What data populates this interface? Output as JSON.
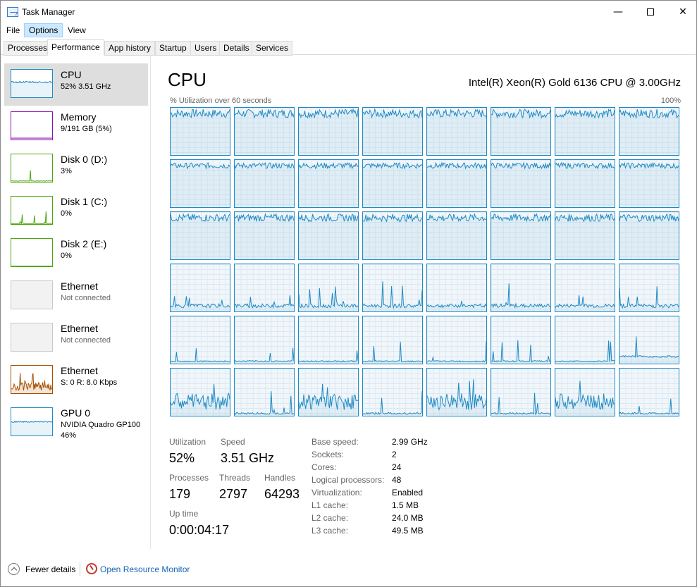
{
  "window": {
    "title": "Task Manager",
    "minimize_glyph": "—",
    "close_glyph": "✕"
  },
  "menu": [
    "File",
    "Options",
    "View"
  ],
  "tabs": [
    "Processes",
    "Performance",
    "App history",
    "Startup",
    "Users",
    "Details",
    "Services"
  ],
  "active_tab": "Performance",
  "sidebar": {
    "items": [
      {
        "name": "CPU",
        "sub": "52%  3.51 GHz",
        "color": "#1f8ac4",
        "selected": true
      },
      {
        "name": "Memory",
        "sub": "9/191 GB (5%)",
        "color": "#8b12ae"
      },
      {
        "name": "Disk 0 (D:)",
        "sub": "3%",
        "color": "#4da60c"
      },
      {
        "name": "Disk 1 (C:)",
        "sub": "0%",
        "color": "#4da60c"
      },
      {
        "name": "Disk 2 (E:)",
        "sub": "0%",
        "color": "#4da60c"
      },
      {
        "name": "Ethernet",
        "sub": "Not connected",
        "color": "#c0c0c0"
      },
      {
        "name": "Ethernet",
        "sub": "Not connected",
        "color": "#c0c0c0"
      },
      {
        "name": "Ethernet",
        "sub": "S: 0  R: 8.0 Kbps",
        "color": "#a74f01"
      },
      {
        "name": "GPU 0",
        "sub": "NVIDIA Quadro GP100",
        "sub2": "46%",
        "color": "#1f8ac4"
      }
    ]
  },
  "main": {
    "title": "CPU",
    "model": "Intel(R) Xeon(R) Gold 6136 CPU @ 3.00GHz",
    "graph_label": "% Utilization over 60 seconds",
    "graph_max": "100%",
    "line_color": "#1f8ac4"
  },
  "stats": {
    "utilization_label": "Utilization",
    "utilization": "52%",
    "speed_label": "Speed",
    "speed": "3.51 GHz",
    "processes_label": "Processes",
    "processes": "179",
    "threads_label": "Threads",
    "threads": "2797",
    "handles_label": "Handles",
    "handles": "64293",
    "uptime_label": "Up time",
    "uptime": "0:00:04:17"
  },
  "specs": [
    {
      "label": "Base speed:",
      "value": "2.99 GHz"
    },
    {
      "label": "Sockets:",
      "value": "2"
    },
    {
      "label": "Cores:",
      "value": "24"
    },
    {
      "label": "Logical processors:",
      "value": "48"
    },
    {
      "label": "Virtualization:",
      "value": "Enabled"
    },
    {
      "label": "L1 cache:",
      "value": "1.5 MB"
    },
    {
      "label": "L2 cache:",
      "value": "24.0 MB"
    },
    {
      "label": "L3 cache:",
      "value": "49.5 MB"
    }
  ],
  "footer": {
    "fewer_details": "Fewer details",
    "open_resource_monitor": "Open Resource Monitor"
  }
}
